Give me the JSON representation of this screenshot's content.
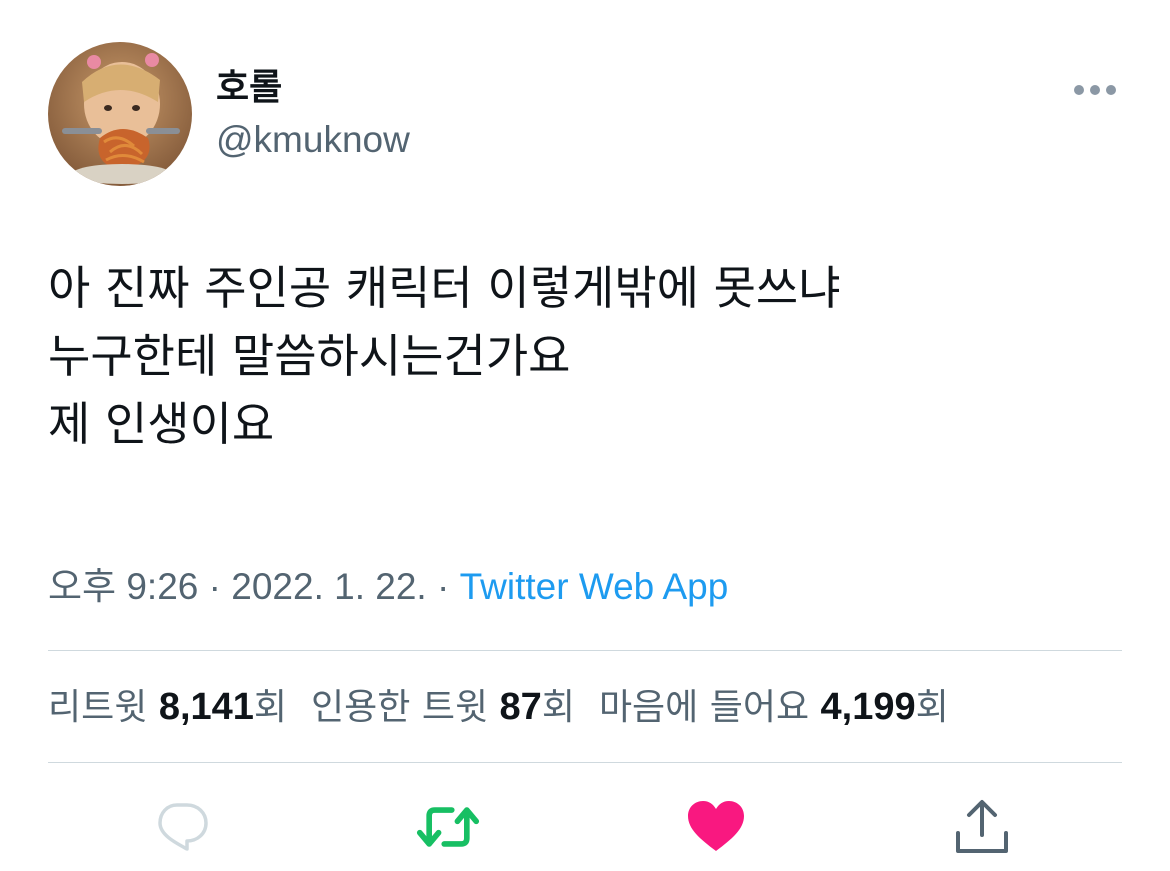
{
  "author": {
    "display_name": "호롤",
    "handle": "@kmuknow"
  },
  "tweet": {
    "lines": [
      "아 진짜 주인공 캐릭터 이렇게밖에 못쓰냐",
      "누구한테 말씀하시는건가요",
      "제 인생이요"
    ]
  },
  "meta": {
    "time": "오후 9:26",
    "separator": " · ",
    "date": "2022. 1. 22.",
    "source": "Twitter Web App"
  },
  "stats": {
    "retweets_label": "리트윗 ",
    "retweets_count": "8,141",
    "retweets_unit": "회",
    "quotes_label": "인용한 트윗 ",
    "quotes_count": "87",
    "quotes_unit": "회",
    "likes_label": "마음에 들어요 ",
    "likes_count": "4,199",
    "likes_unit": "회"
  },
  "icons": {
    "more": "more-icon",
    "reply": "reply-icon",
    "retweet": "retweet-icon",
    "like": "heart-icon",
    "share": "share-icon"
  },
  "colors": {
    "retweet_active": "#17bf63",
    "like_active": "#f91880",
    "link": "#1d9bf0",
    "secondary_text": "#536471"
  }
}
